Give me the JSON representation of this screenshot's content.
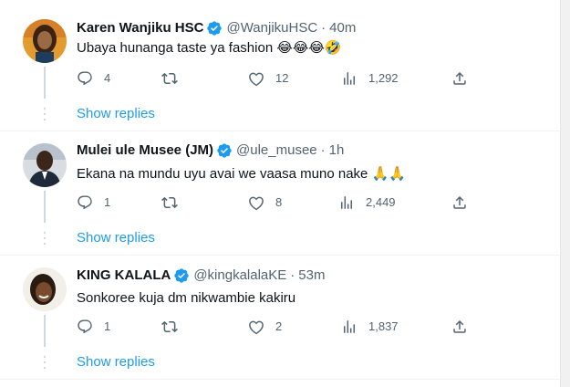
{
  "colors": {
    "accent": "#1d9bf0",
    "verified": "#1d9bf0",
    "muted": "#536471",
    "text": "#0f1419",
    "divider": "#eff3f4"
  },
  "tweets": [
    {
      "author": "Karen Wanjiku HSC",
      "handle": "@WanjikuHSC",
      "time": "40m",
      "text": "Ubaya hunanga taste ya fashion 😂😂😂🤣",
      "replies": "4",
      "retweets": "",
      "likes": "12",
      "views": "1,292",
      "show_replies": "Show replies"
    },
    {
      "author": "Mulei ule Musee (JM)",
      "handle": "@ule_musee",
      "time": "1h",
      "text": "Ekana na mundu uyu avai we vaasa muno nake 🙏🙏",
      "replies": "1",
      "retweets": "",
      "likes": "8",
      "views": "2,449",
      "show_replies": "Show replies"
    },
    {
      "author": "KING KALALA",
      "handle": "@kingkalalaKE",
      "time": "53m",
      "text": "Sonkoree kuja dm nikwambie kakiru",
      "replies": "1",
      "retweets": "",
      "likes": "2",
      "views": "1,837",
      "show_replies": "Show replies"
    }
  ],
  "dot_separator": "·",
  "icons": [
    "reply-icon",
    "retweet-icon",
    "like-icon",
    "views-icon",
    "share-icon",
    "verified-badge-icon"
  ]
}
